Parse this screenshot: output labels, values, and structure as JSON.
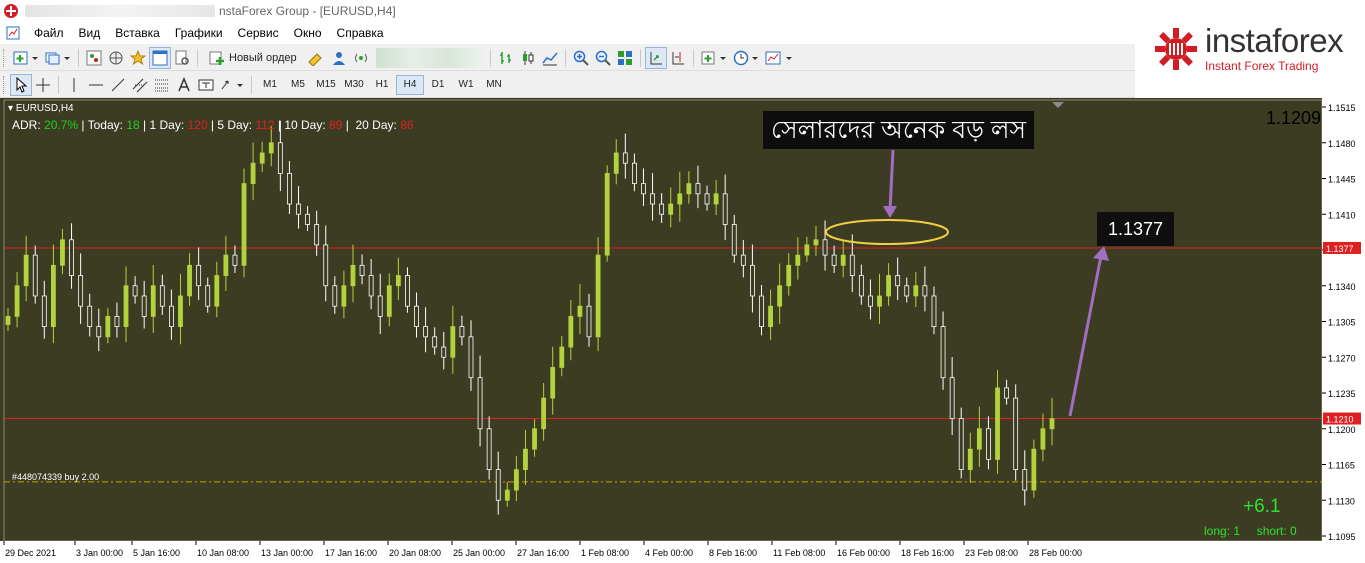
{
  "window": {
    "title": "nstaForex Group - [EURUSD,H4]"
  },
  "menu": [
    "Файл",
    "Вид",
    "Вставка",
    "Графики",
    "Сервис",
    "Окно",
    "Справка"
  ],
  "toolbar": {
    "new_order_label": "Новый ордер",
    "timeframes": [
      "M1",
      "M5",
      "M15",
      "M30",
      "H1",
      "H4",
      "D1",
      "W1",
      "MN"
    ],
    "active_timeframe": "H4"
  },
  "logo": {
    "name": "instaforex",
    "tagline": "Instant Forex Trading",
    "accent_color": "#d11c24"
  },
  "chart": {
    "symbol_label": "EURUSD,H4",
    "current_price_display": "1.1209",
    "adr": {
      "label": "ADR:",
      "adr_value": "20.7%",
      "today_label": "Today:",
      "today_value": "18",
      "day1_label": "1 Day:",
      "day1_value": "120",
      "day5_label": "5 Day:",
      "day5_value": "112",
      "day10_label": "10 Day:",
      "day10_value": "89",
      "day20_label": "20 Day:",
      "day20_value": "86"
    },
    "annotation_text": "সেলারদের অনেক বড় লস",
    "target_label": "1.1377",
    "order_label": "#448074339 buy 2.00",
    "pnl": "+6.1",
    "long_label": "long: 1",
    "short_label": "short: 0",
    "price_marker_upper": "1.1377",
    "price_marker_lower": "1.1210",
    "colors": {
      "background": "#3c3c23",
      "candles": "#b4d23c",
      "candles_down": "#ffffff",
      "level_line": "#e02020",
      "order_line": "#c8a000",
      "arrow": "#a070c0",
      "ellipse": "#f0d040"
    }
  },
  "chart_data": {
    "type": "candlestick",
    "symbol": "EURUSD",
    "timeframe": "H4",
    "ylim": [
      1.1095,
      1.1515
    ],
    "y_ticks": [
      "1.1515",
      "1.1480",
      "1.1445",
      "1.1410",
      "1.1375",
      "1.1340",
      "1.1305",
      "1.1270",
      "1.1235",
      "1.1200",
      "1.1165",
      "1.1130",
      "1.1095"
    ],
    "x_ticks": [
      "29 Dec 2021",
      "3 Jan 00:00",
      "5 Jan 16:00",
      "10 Jan 08:00",
      "13 Jan 00:00",
      "17 Jan 16:00",
      "20 Jan 08:00",
      "25 Jan 00:00",
      "27 Jan 16:00",
      "1 Feb 08:00",
      "4 Feb 00:00",
      "8 Feb 16:00",
      "11 Feb 08:00",
      "16 Feb 00:00",
      "18 Feb 16:00",
      "23 Feb 08:00",
      "28 Feb 00:00"
    ],
    "horizontal_levels": [
      {
        "price": 1.1377,
        "color": "#e02020"
      },
      {
        "price": 1.121,
        "color": "#e02020"
      },
      {
        "price": 1.1148,
        "color": "#c8a000",
        "style": "dash-dot"
      }
    ],
    "close_path": [
      1.131,
      1.134,
      1.137,
      1.133,
      1.13,
      1.136,
      1.1385,
      1.135,
      1.132,
      1.13,
      1.129,
      1.131,
      1.13,
      1.134,
      1.133,
      1.131,
      1.134,
      1.132,
      1.13,
      1.133,
      1.136,
      1.134,
      1.132,
      1.135,
      1.137,
      1.136,
      1.144,
      1.146,
      1.147,
      1.148,
      1.145,
      1.142,
      1.141,
      1.14,
      1.138,
      1.134,
      1.132,
      1.134,
      1.136,
      1.135,
      1.133,
      1.131,
      1.134,
      1.135,
      1.132,
      1.13,
      1.129,
      1.128,
      1.127,
      1.13,
      1.129,
      1.125,
      1.12,
      1.116,
      1.113,
      1.114,
      1.116,
      1.118,
      1.12,
      1.123,
      1.126,
      1.128,
      1.131,
      1.132,
      1.129,
      1.137,
      1.145,
      1.147,
      1.146,
      1.144,
      1.143,
      1.142,
      1.141,
      1.142,
      1.143,
      1.144,
      1.143,
      1.142,
      1.143,
      1.14,
      1.137,
      1.136,
      1.133,
      1.13,
      1.132,
      1.134,
      1.136,
      1.137,
      1.138,
      1.1385,
      1.137,
      1.136,
      1.137,
      1.135,
      1.133,
      1.132,
      1.133,
      1.135,
      1.134,
      1.133,
      1.134,
      1.133,
      1.13,
      1.125,
      1.121,
      1.116,
      1.118,
      1.12,
      1.117,
      1.124,
      1.123,
      1.116,
      1.114,
      1.118,
      1.12,
      1.121
    ]
  }
}
